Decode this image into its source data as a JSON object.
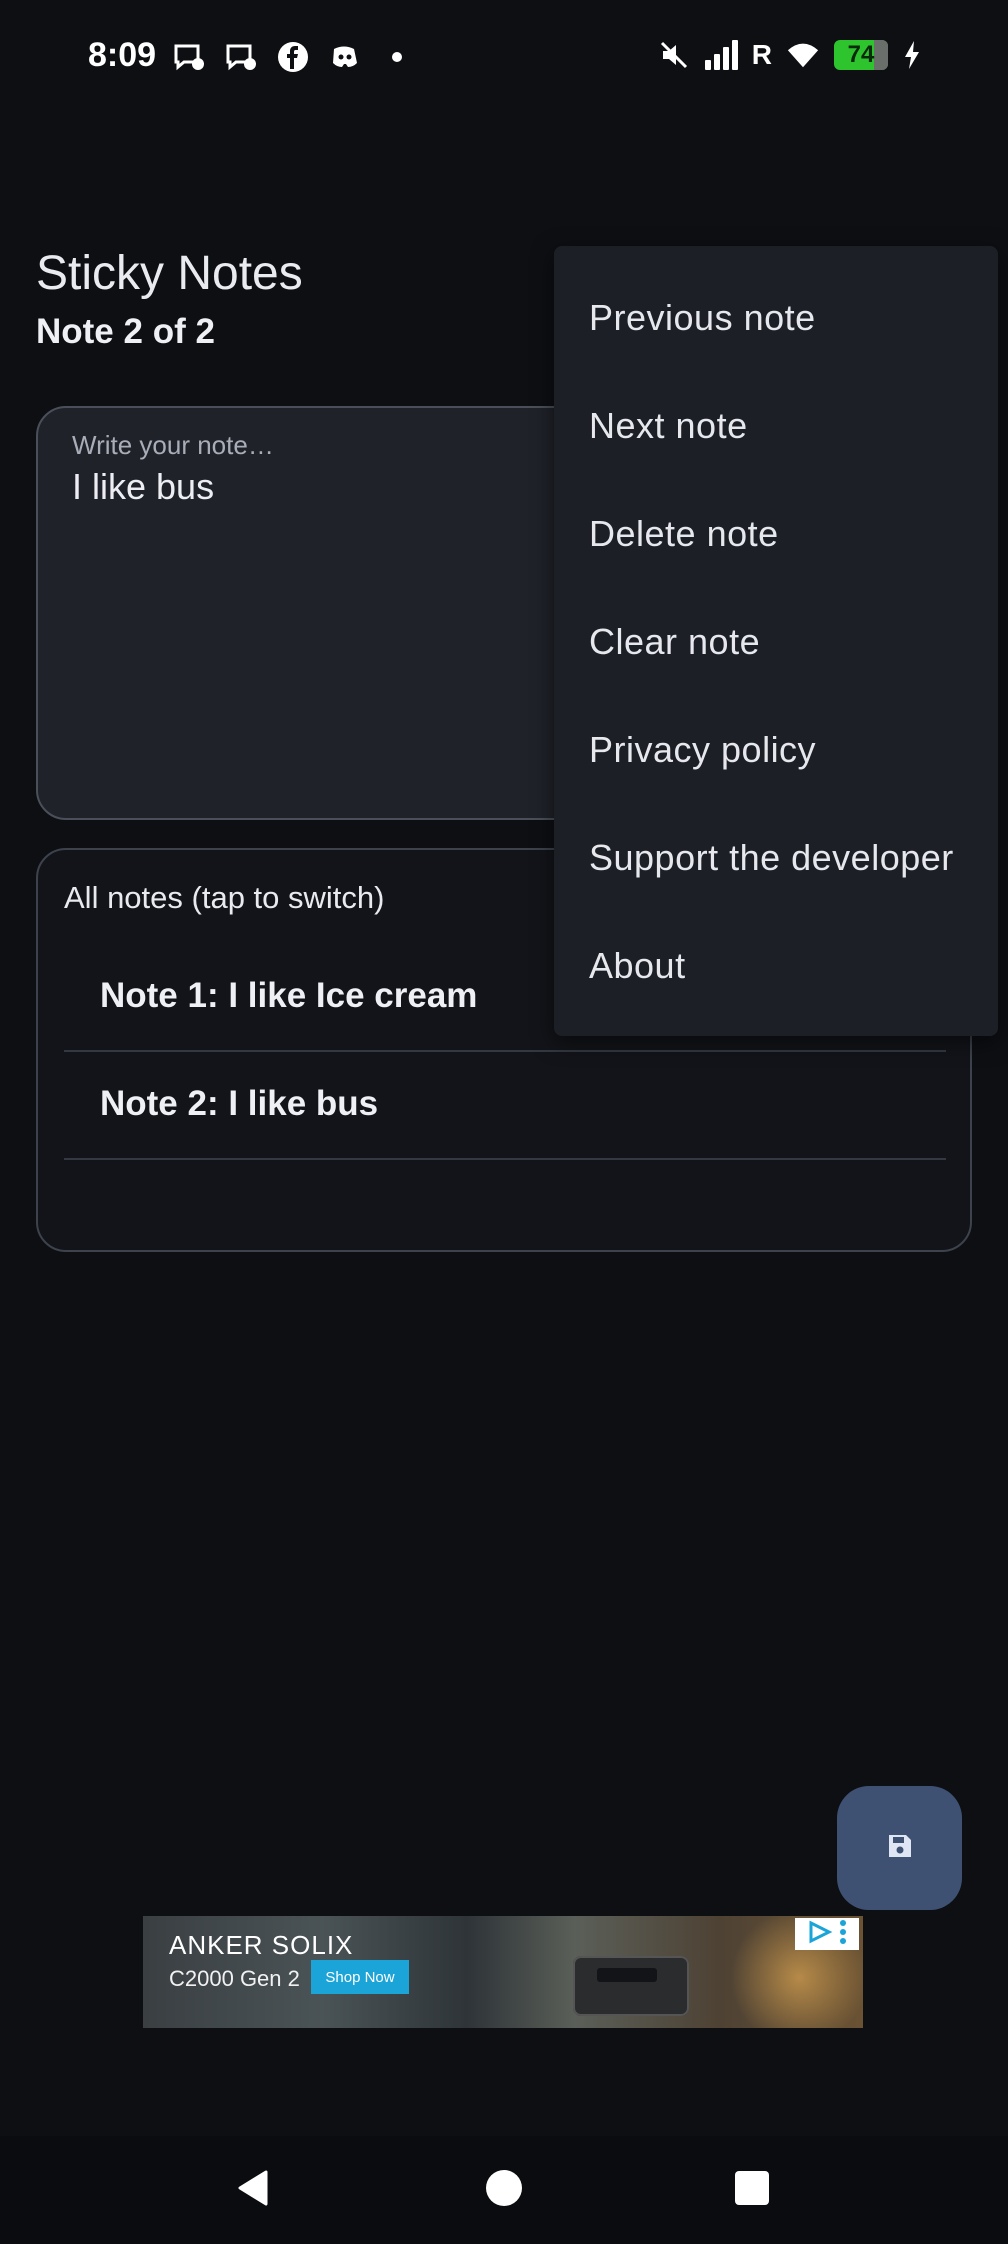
{
  "status_bar": {
    "time": "8:09",
    "battery_level": "74",
    "network_label": "R",
    "notification_icons": [
      "messenger-icon",
      "messenger-icon",
      "facebook-icon",
      "discord-icon",
      "dot-icon"
    ],
    "system_icons": [
      "mute-icon",
      "signal-icon",
      "wifi-icon",
      "battery-icon",
      "charging-icon"
    ]
  },
  "header": {
    "title": "Sticky Notes",
    "subtitle": "Note 2 of 2"
  },
  "editor": {
    "placeholder": "Write your note…",
    "value": "I like bus"
  },
  "notes_list": {
    "title": "All notes (tap to switch)",
    "items": [
      {
        "label": "Note 1: I like Ice cream"
      },
      {
        "label": "Note 2: I like bus"
      }
    ]
  },
  "menu": {
    "items": [
      {
        "label": "Previous note"
      },
      {
        "label": "Next note"
      },
      {
        "label": "Delete note"
      },
      {
        "label": "Clear note"
      },
      {
        "label": "Privacy policy"
      },
      {
        "label": "Support the developer"
      },
      {
        "label": "About"
      }
    ]
  },
  "fab": {
    "icon": "save-icon"
  },
  "ad": {
    "brand": "ANKER SOLIX",
    "product": "C2000 Gen 2",
    "cta": "Shop Now"
  },
  "nav": {
    "icons": [
      "back-icon",
      "home-icon",
      "recents-icon"
    ]
  },
  "colors": {
    "background": "#0d0f13",
    "editor_bg": "#1f2229",
    "menu_bg": "#1c1f25",
    "fab_bg": "#3f5173",
    "battery": "#2ec42e"
  }
}
